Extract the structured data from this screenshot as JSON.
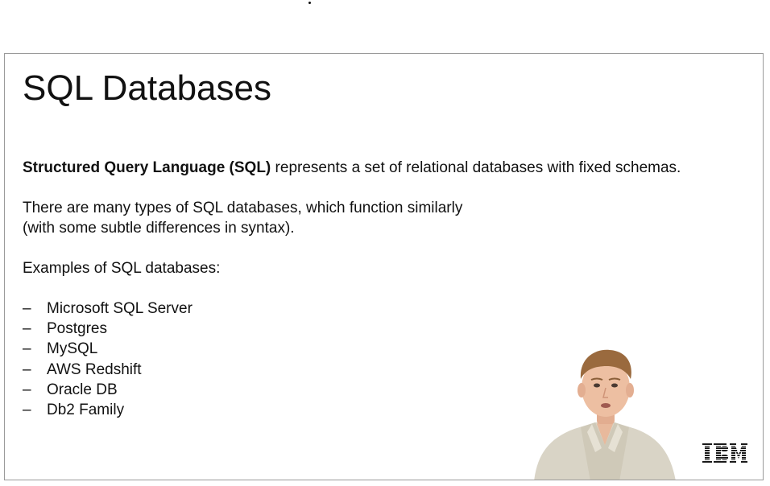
{
  "slide": {
    "title": "SQL Databases",
    "intro_bold": "Structured Query Language (SQL)",
    "intro_rest": " represents a set of relational databases with fixed schemas.",
    "para2_line1": "There are many types of SQL databases, which function similarly",
    "para2_line2": "(with some subtle differences in syntax).",
    "examples_heading": "Examples of SQL databases:",
    "bullet_marker": "–",
    "examples": [
      "Microsoft SQL Server",
      "Postgres",
      "MySQL",
      "AWS Redshift",
      "Oracle DB",
      "Db2 Family"
    ]
  },
  "branding": {
    "logo": "IBM",
    "logo_icon": "ibm-logo-icon"
  },
  "colors": {
    "text": "#111111",
    "slide_border": "#9a9a9a",
    "logo": "#1a1a1a"
  }
}
